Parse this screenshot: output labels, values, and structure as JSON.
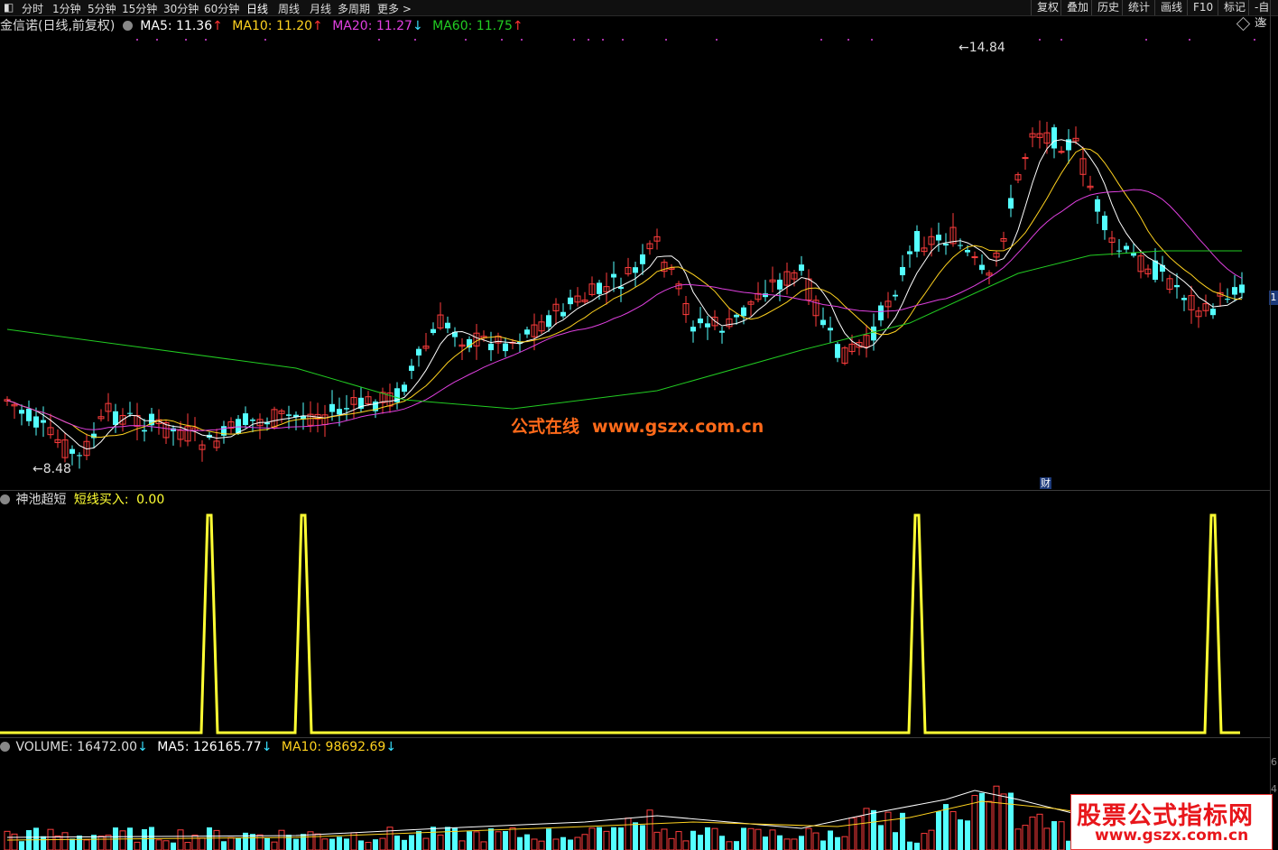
{
  "toolbar": {
    "left_items": [
      "分时",
      "1分钟",
      "5分钟",
      "15分钟",
      "30分钟",
      "60分钟",
      "日线",
      "周线",
      "月线",
      "多周期",
      "更多 >"
    ],
    "active": "日线",
    "right_items": [
      "复权",
      "叠加",
      "历史",
      "统计",
      "画线",
      "F10",
      "标记",
      "-自选"
    ]
  },
  "main_panel": {
    "title": "金信诺(日线,前复权)",
    "ma5": {
      "label": "MA5:",
      "value": "11.36",
      "arrow": "↑",
      "color": "#ffffff"
    },
    "ma10": {
      "label": "MA10:",
      "value": "11.20",
      "arrow": "↑",
      "color": "#ffd21f"
    },
    "ma20": {
      "label": "MA20:",
      "value": "11.27",
      "arrow": "↓",
      "color": "#e040e0"
    },
    "ma60": {
      "label": "MA60:",
      "value": "11.75",
      "arrow": "↑",
      "color": "#22cc22"
    },
    "high_label": "14.84",
    "low_label": "8.48",
    "cai_badge": "财",
    "price_tag": "1",
    "watermark_cn": "公式在线",
    "watermark_url": "www.gszx.com.cn"
  },
  "indicator_panel": {
    "name": "神池超短",
    "line_label": "短线买入:",
    "line_value": "0.00",
    "color": "#ffff33"
  },
  "volume_panel": {
    "volume": {
      "label": "VOLUME:",
      "value": "16472.00",
      "arrow": "↓"
    },
    "ma5": {
      "label": "MA5:",
      "value": "126165.77",
      "arrow": "↓"
    },
    "ma10": {
      "label": "MA10:",
      "value": "98692.69",
      "arrow": "↓"
    },
    "axis_labels": [
      "6",
      "4"
    ]
  },
  "brand": {
    "line1": "股票公式指标网",
    "line2": "www.gszx.com.cn"
  },
  "colors": {
    "up": "#ff3d3d",
    "down": "#54ffff",
    "ma60": "#22cc22",
    "ma20": "#e040e0",
    "ma10": "#ffd21f",
    "ma5": "#ffffff"
  },
  "chart_data": {
    "type": "candlestick",
    "price_range": [
      8.48,
      14.84
    ],
    "n_bars": 172,
    "buy_signal_bars": [
      28,
      41,
      126,
      167
    ]
  }
}
